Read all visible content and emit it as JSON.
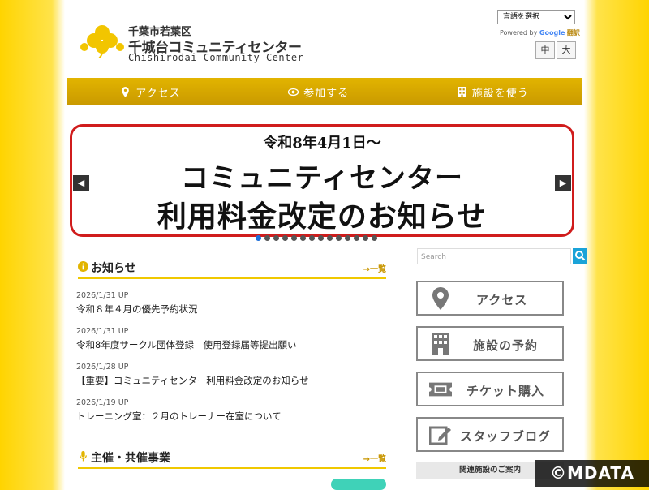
{
  "header": {
    "ward": "千葉市若葉区",
    "name": "千城台コミュニティセンター",
    "name_en": "Chishirodai Community Center",
    "lang_select": "言語を選択",
    "powered_prefix": "Powered by",
    "powered_google": "Google",
    "powered_translate": "翻訳",
    "font_medium": "中",
    "font_large": "大"
  },
  "nav": {
    "access": "アクセス",
    "join": "参加する",
    "use": "施設を使う"
  },
  "banner": {
    "date": "令和8年4月1日～",
    "line1": "コミュニティセンター",
    "line2": "利用料金改定のお知らせ",
    "slide_count": 14,
    "active_slide": 1
  },
  "news": {
    "title": "お知らせ",
    "more": "一覧",
    "items": [
      {
        "date": "2026/1/31 UP",
        "title": "令和８年４月の優先予約状況"
      },
      {
        "date": "2026/1/31 UP",
        "title": "令和8年度サークル団体登録　使用登録届等提出願い"
      },
      {
        "date": "2026/1/28 UP",
        "title": "【重要】コミュニティセンター利用料金改定のお知らせ"
      },
      {
        "date": "2026/1/19 UP",
        "title": "トレーニング室：２月のトレーナー在室について"
      }
    ]
  },
  "events": {
    "title": "主催・共催事業",
    "more": "一覧"
  },
  "sidebar": {
    "search_placeholder": "Search",
    "buttons": [
      {
        "label": "アクセス",
        "icon": "map-pin-icon"
      },
      {
        "label": "施設の予約",
        "icon": "building-icon"
      },
      {
        "label": "チケット購入",
        "icon": "ticket-icon"
      },
      {
        "label": "スタッフブログ",
        "icon": "pencil-icon"
      }
    ],
    "related": "関連施設のご案内"
  },
  "watermark": "©MDATA",
  "colors": {
    "accent": "#e2b400",
    "banner_border": "#d01c1c",
    "search_btn": "#1aa3d8"
  }
}
